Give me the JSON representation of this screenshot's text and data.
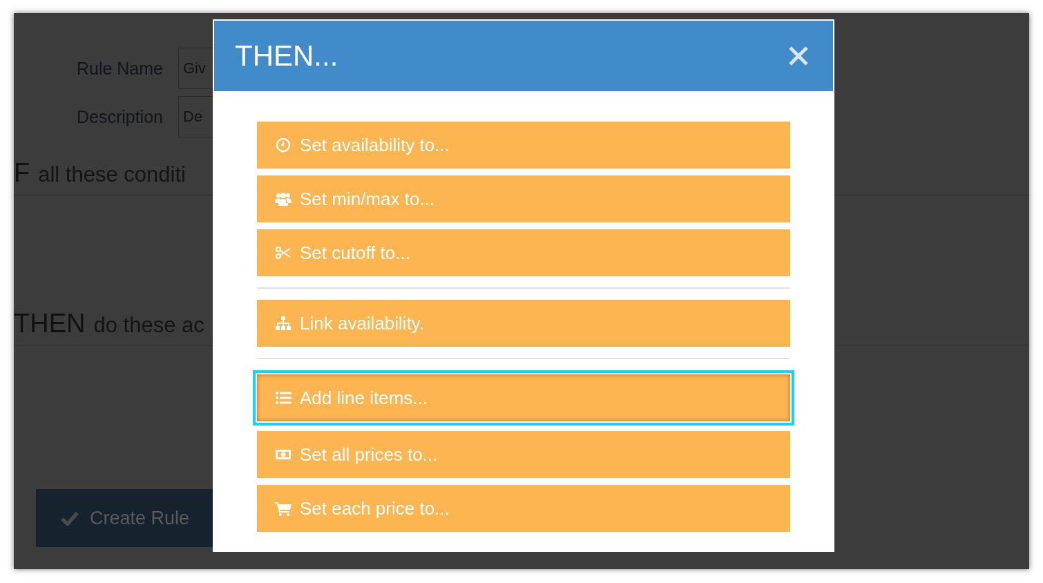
{
  "page": {
    "fields": [
      {
        "label": "Rule Name",
        "placeholder": "Giv"
      },
      {
        "label": "Description",
        "placeholder": "De"
      }
    ],
    "sections": [
      {
        "keyword": "F",
        "text": "all these conditi"
      },
      {
        "keyword": "THEN",
        "text": "do these ac"
      }
    ],
    "submit_button": "Create Rule"
  },
  "modal": {
    "title": "THEN...",
    "groups": [
      [
        {
          "label": "Set availability to...",
          "selected": false
        },
        {
          "label": "Set min/max to...",
          "selected": false
        },
        {
          "label": "Set cutoff to...",
          "selected": false
        }
      ],
      [
        {
          "label": "Link availability.",
          "selected": false
        }
      ],
      [
        {
          "label": "Add line items...",
          "selected": true
        },
        {
          "label": "Set all prices to...",
          "selected": false
        },
        {
          "label": "Set each price to...",
          "selected": false
        }
      ]
    ]
  }
}
